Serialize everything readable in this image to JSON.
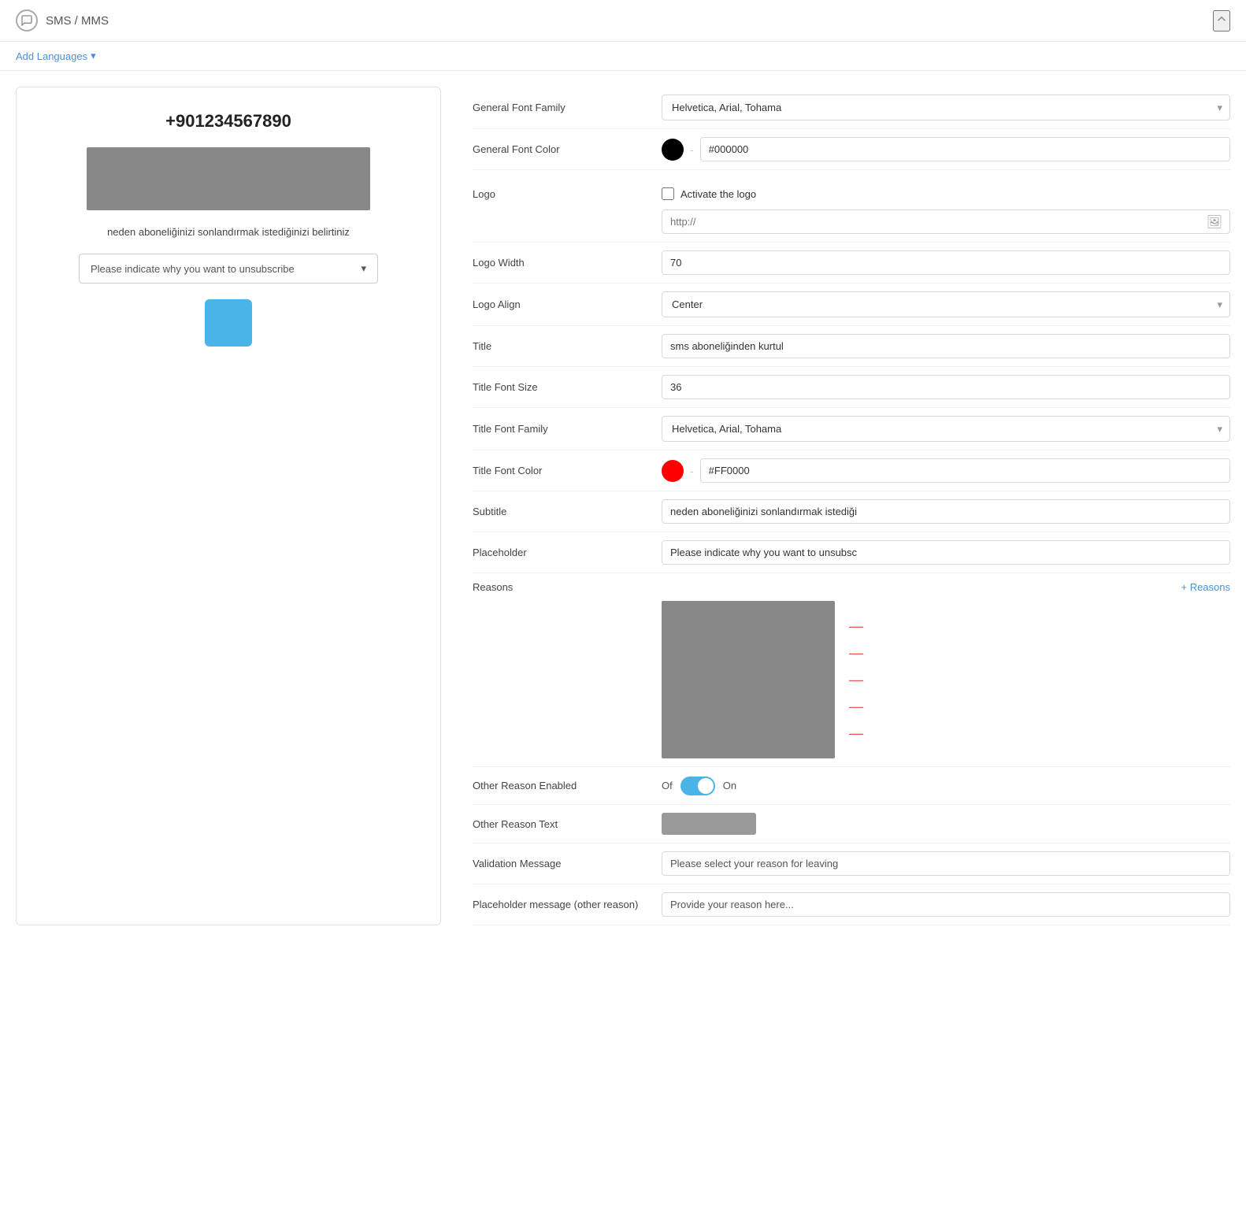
{
  "header": {
    "title": "SMS / MMS",
    "collapse_label": "collapse"
  },
  "toolbar": {
    "add_languages_label": "Add Languages"
  },
  "preview": {
    "phone": "+901234567890",
    "subtitle": "neden aboneliğinizi sonlandırmak istediğinizi belirtiniz",
    "dropdown_placeholder": "Please indicate why you want to unsubscribe"
  },
  "settings": {
    "general_font_family": {
      "label": "General Font Family",
      "value": "Helvetica, Arial, Tohama"
    },
    "general_font_color": {
      "label": "General Font Color",
      "color": "#000000",
      "hex": "#000000"
    },
    "logo": {
      "label": "Logo",
      "activate_label": "Activate the logo",
      "url_placeholder": "http://"
    },
    "logo_width": {
      "label": "Logo Width",
      "value": "70"
    },
    "logo_align": {
      "label": "Logo Align",
      "value": "Center"
    },
    "title": {
      "label": "Title",
      "value": "sms aboneliğinden kurtul"
    },
    "title_font_size": {
      "label": "Title Font Size",
      "value": "36"
    },
    "title_font_family": {
      "label": "Title Font Family",
      "value": "Helvetica, Arial, Tohama"
    },
    "title_font_color": {
      "label": "Title Font Color",
      "color": "#FF0000",
      "hex": "#FF0000"
    },
    "subtitle": {
      "label": "Subtitle",
      "value": "neden aboneliğinizi sonlandırmak istediği"
    },
    "placeholder": {
      "label": "Placeholder",
      "value": "Please indicate why you want to unsubsc"
    },
    "reasons": {
      "label": "Reasons",
      "add_label": "+ Reasons"
    },
    "other_reason_enabled": {
      "label": "Other Reason Enabled",
      "off_label": "Of",
      "on_label": "On"
    },
    "other_reason_text": {
      "label": "Other Reason Text"
    },
    "validation_message": {
      "label": "Validation Message",
      "value": "Please select your reason for leaving"
    },
    "placeholder_other_reason": {
      "label": "Placeholder message (other reason)",
      "value": "Provide your reason here..."
    }
  }
}
